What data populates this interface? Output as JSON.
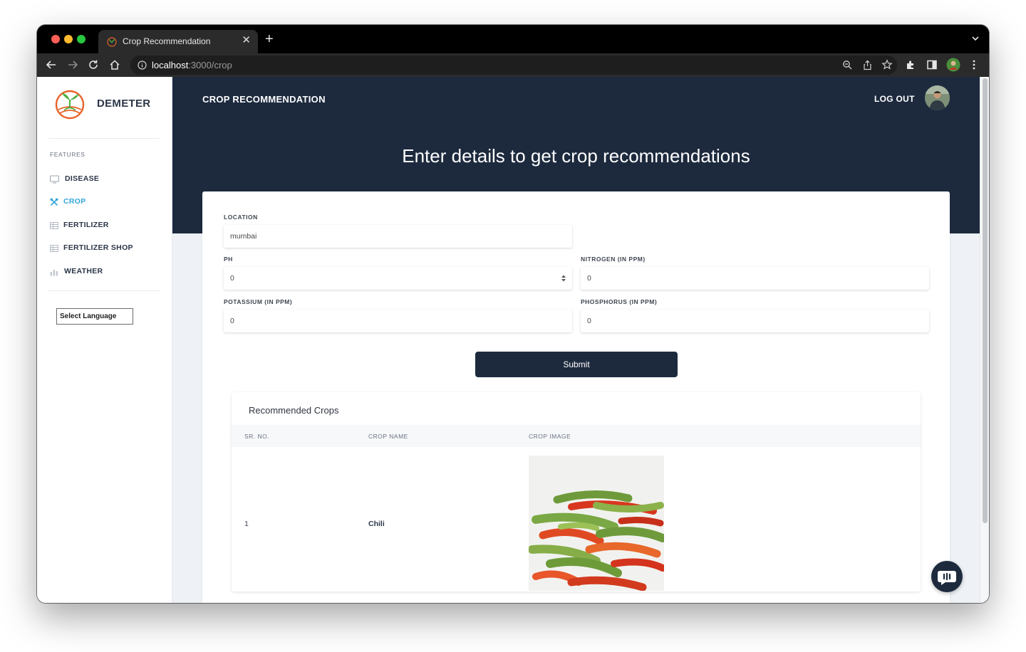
{
  "browser": {
    "tab_title": "Crop Recommendation",
    "tab_close": "✕",
    "new_tab": "+",
    "url_host": "localhost",
    "url_path": ":3000/crop"
  },
  "sidebar": {
    "brand": "DEMETER",
    "section_label": "FEATURES",
    "items": [
      {
        "label": "DISEASE",
        "icon": "monitor-icon",
        "active": false
      },
      {
        "label": "CROP",
        "icon": "tools-icon",
        "active": true
      },
      {
        "label": "FERTILIZER",
        "icon": "table-icon",
        "active": false
      },
      {
        "label": "FERTILIZER SHOP",
        "icon": "table-icon",
        "active": false
      },
      {
        "label": "WEATHER",
        "icon": "bar-chart-icon",
        "active": false
      }
    ],
    "language_select": "Select Language"
  },
  "header": {
    "title": "CROP RECOMMENDATION",
    "logout": "LOG OUT",
    "heading": "Enter details to get crop recommendations"
  },
  "form": {
    "location_label": "LOCATION",
    "location_value": "mumbai",
    "ph_label": "PH",
    "ph_value": "0",
    "nitrogen_label": "NITROGEN (IN PPM)",
    "nitrogen_value": "0",
    "potassium_label": "POTASSIUM (IN PPM)",
    "potassium_value": "0",
    "phosphorus_label": "PHOSPHORUS (IN PPM)",
    "phosphorus_value": "0",
    "submit_label": "Submit"
  },
  "results": {
    "title": "Recommended Crops",
    "columns": [
      "SR. NO.",
      "CROP NAME",
      "CROP IMAGE"
    ],
    "rows": [
      {
        "sr_no": "1",
        "crop_name": "Chili",
        "image": "chili-peppers-photo"
      }
    ]
  },
  "colors": {
    "navy": "#1d2a3e",
    "accent": "#34a6d8",
    "logo_orange": "#e8632b",
    "logo_green": "#4caf3e"
  }
}
